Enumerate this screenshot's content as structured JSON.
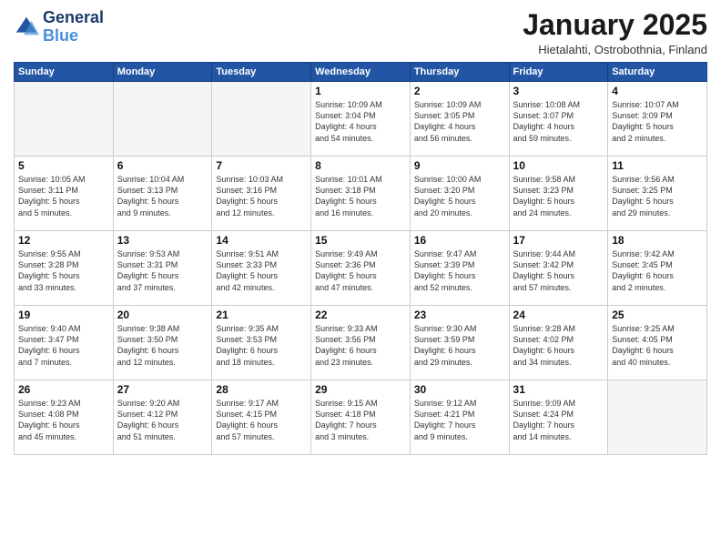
{
  "header": {
    "logo_general": "General",
    "logo_blue": "Blue",
    "title": "January 2025",
    "location": "Hietalahti, Ostrobothnia, Finland"
  },
  "days_of_week": [
    "Sunday",
    "Monday",
    "Tuesday",
    "Wednesday",
    "Thursday",
    "Friday",
    "Saturday"
  ],
  "weeks": [
    [
      {
        "day": "",
        "text": ""
      },
      {
        "day": "",
        "text": ""
      },
      {
        "day": "",
        "text": ""
      },
      {
        "day": "1",
        "text": "Sunrise: 10:09 AM\nSunset: 3:04 PM\nDaylight: 4 hours\nand 54 minutes."
      },
      {
        "day": "2",
        "text": "Sunrise: 10:09 AM\nSunset: 3:05 PM\nDaylight: 4 hours\nand 56 minutes."
      },
      {
        "day": "3",
        "text": "Sunrise: 10:08 AM\nSunset: 3:07 PM\nDaylight: 4 hours\nand 59 minutes."
      },
      {
        "day": "4",
        "text": "Sunrise: 10:07 AM\nSunset: 3:09 PM\nDaylight: 5 hours\nand 2 minutes."
      }
    ],
    [
      {
        "day": "5",
        "text": "Sunrise: 10:05 AM\nSunset: 3:11 PM\nDaylight: 5 hours\nand 5 minutes."
      },
      {
        "day": "6",
        "text": "Sunrise: 10:04 AM\nSunset: 3:13 PM\nDaylight: 5 hours\nand 9 minutes."
      },
      {
        "day": "7",
        "text": "Sunrise: 10:03 AM\nSunset: 3:16 PM\nDaylight: 5 hours\nand 12 minutes."
      },
      {
        "day": "8",
        "text": "Sunrise: 10:01 AM\nSunset: 3:18 PM\nDaylight: 5 hours\nand 16 minutes."
      },
      {
        "day": "9",
        "text": "Sunrise: 10:00 AM\nSunset: 3:20 PM\nDaylight: 5 hours\nand 20 minutes."
      },
      {
        "day": "10",
        "text": "Sunrise: 9:58 AM\nSunset: 3:23 PM\nDaylight: 5 hours\nand 24 minutes."
      },
      {
        "day": "11",
        "text": "Sunrise: 9:56 AM\nSunset: 3:25 PM\nDaylight: 5 hours\nand 29 minutes."
      }
    ],
    [
      {
        "day": "12",
        "text": "Sunrise: 9:55 AM\nSunset: 3:28 PM\nDaylight: 5 hours\nand 33 minutes."
      },
      {
        "day": "13",
        "text": "Sunrise: 9:53 AM\nSunset: 3:31 PM\nDaylight: 5 hours\nand 37 minutes."
      },
      {
        "day": "14",
        "text": "Sunrise: 9:51 AM\nSunset: 3:33 PM\nDaylight: 5 hours\nand 42 minutes."
      },
      {
        "day": "15",
        "text": "Sunrise: 9:49 AM\nSunset: 3:36 PM\nDaylight: 5 hours\nand 47 minutes."
      },
      {
        "day": "16",
        "text": "Sunrise: 9:47 AM\nSunset: 3:39 PM\nDaylight: 5 hours\nand 52 minutes."
      },
      {
        "day": "17",
        "text": "Sunrise: 9:44 AM\nSunset: 3:42 PM\nDaylight: 5 hours\nand 57 minutes."
      },
      {
        "day": "18",
        "text": "Sunrise: 9:42 AM\nSunset: 3:45 PM\nDaylight: 6 hours\nand 2 minutes."
      }
    ],
    [
      {
        "day": "19",
        "text": "Sunrise: 9:40 AM\nSunset: 3:47 PM\nDaylight: 6 hours\nand 7 minutes."
      },
      {
        "day": "20",
        "text": "Sunrise: 9:38 AM\nSunset: 3:50 PM\nDaylight: 6 hours\nand 12 minutes."
      },
      {
        "day": "21",
        "text": "Sunrise: 9:35 AM\nSunset: 3:53 PM\nDaylight: 6 hours\nand 18 minutes."
      },
      {
        "day": "22",
        "text": "Sunrise: 9:33 AM\nSunset: 3:56 PM\nDaylight: 6 hours\nand 23 minutes."
      },
      {
        "day": "23",
        "text": "Sunrise: 9:30 AM\nSunset: 3:59 PM\nDaylight: 6 hours\nand 29 minutes."
      },
      {
        "day": "24",
        "text": "Sunrise: 9:28 AM\nSunset: 4:02 PM\nDaylight: 6 hours\nand 34 minutes."
      },
      {
        "day": "25",
        "text": "Sunrise: 9:25 AM\nSunset: 4:05 PM\nDaylight: 6 hours\nand 40 minutes."
      }
    ],
    [
      {
        "day": "26",
        "text": "Sunrise: 9:23 AM\nSunset: 4:08 PM\nDaylight: 6 hours\nand 45 minutes."
      },
      {
        "day": "27",
        "text": "Sunrise: 9:20 AM\nSunset: 4:12 PM\nDaylight: 6 hours\nand 51 minutes."
      },
      {
        "day": "28",
        "text": "Sunrise: 9:17 AM\nSunset: 4:15 PM\nDaylight: 6 hours\nand 57 minutes."
      },
      {
        "day": "29",
        "text": "Sunrise: 9:15 AM\nSunset: 4:18 PM\nDaylight: 7 hours\nand 3 minutes."
      },
      {
        "day": "30",
        "text": "Sunrise: 9:12 AM\nSunset: 4:21 PM\nDaylight: 7 hours\nand 9 minutes."
      },
      {
        "day": "31",
        "text": "Sunrise: 9:09 AM\nSunset: 4:24 PM\nDaylight: 7 hours\nand 14 minutes."
      },
      {
        "day": "",
        "text": ""
      }
    ]
  ]
}
